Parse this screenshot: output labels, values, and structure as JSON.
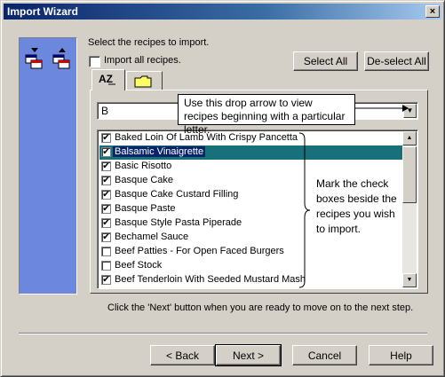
{
  "window": {
    "title": "Import Wizard",
    "close_glyph": "×"
  },
  "header": {
    "instruction": "Select the recipes to import.",
    "import_all_label": "Import all recipes.",
    "select_all": "Select All",
    "deselect_all": "De-select All"
  },
  "tabs": [
    {
      "label": "AZ",
      "icon": "alphabetical-sort-icon"
    },
    {
      "label": "",
      "icon": "folder-icon"
    }
  ],
  "letter_select": {
    "value": "B",
    "arrow_glyph": "▼"
  },
  "callouts": {
    "drop_arrow": "Use this drop arrow to view recipes beginning with a particular letter.",
    "check_boxes": "Mark the check boxes beside the recipes you wish to import."
  },
  "recipes": [
    {
      "name": "Baked Loin Of Lamb With Crispy Pancetta",
      "checked": true,
      "selected": false
    },
    {
      "name": "Balsamic Vinaigrette",
      "checked": true,
      "selected": true
    },
    {
      "name": "Basic Risotto",
      "checked": true,
      "selected": false
    },
    {
      "name": "Basque Cake",
      "checked": true,
      "selected": false
    },
    {
      "name": "Basque Cake Custard Filling",
      "checked": true,
      "selected": false
    },
    {
      "name": "Basque Paste",
      "checked": true,
      "selected": false
    },
    {
      "name": "Basque Style Pasta Piperade",
      "checked": true,
      "selected": false
    },
    {
      "name": "Bechamel Sauce",
      "checked": true,
      "selected": false
    },
    {
      "name": "Beef Patties - For Open Faced Burgers",
      "checked": false,
      "selected": false
    },
    {
      "name": "Beef Stock",
      "checked": false,
      "selected": false
    },
    {
      "name": "Beef Tenderloin With Seeded Mustard Mash",
      "checked": true,
      "selected": false
    }
  ],
  "check_glyph": "✔",
  "scroll": {
    "up_glyph": "▲",
    "down_glyph": "▼"
  },
  "footer": {
    "hint": "Click the 'Next' button when you are ready to move on to the next step.",
    "back": "< Back",
    "next": "Next >",
    "cancel": "Cancel",
    "help": "Help"
  },
  "colors": {
    "side_panel": "#6b87de",
    "selection": "#0a246a",
    "titlebar": "#0a246a"
  }
}
